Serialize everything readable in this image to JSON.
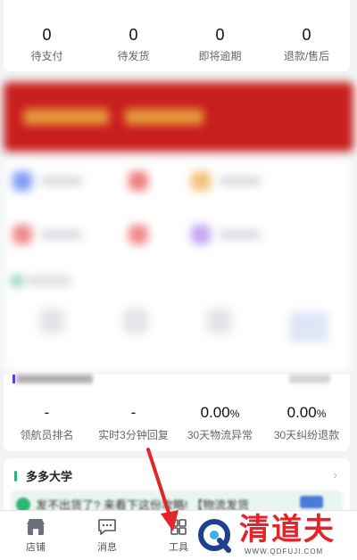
{
  "order_stats": [
    {
      "value": "0",
      "label": "待支付"
    },
    {
      "value": "0",
      "label": "待发货"
    },
    {
      "value": "0",
      "label": "即将逾期"
    },
    {
      "value": "0",
      "label": "退款/售后"
    }
  ],
  "metrics": [
    {
      "value": "-",
      "unit": "",
      "label": "领航员排名"
    },
    {
      "value": "-",
      "unit": "",
      "label": "实时3分钟回复"
    },
    {
      "value": "0.00",
      "unit": "%",
      "label": "30天物流异常"
    },
    {
      "value": "0.00",
      "unit": "%",
      "label": "30天纠纷退款"
    }
  ],
  "university": {
    "title": "多多大学",
    "item_text": "发不出货了? 来看下这份攻略! 【物流发货"
  },
  "tabbar": [
    {
      "label": "店铺",
      "icon": "shop-icon"
    },
    {
      "label": "消息",
      "icon": "message-icon"
    },
    {
      "label": "工具",
      "icon": "tools-icon"
    }
  ],
  "watermark": {
    "name": "清道夫",
    "url": "WWW.QDFUJI.COM"
  },
  "colors": {
    "banner": "#c81e1e",
    "accent_green": "#2bb673",
    "arrow_red": "#e5232b"
  }
}
